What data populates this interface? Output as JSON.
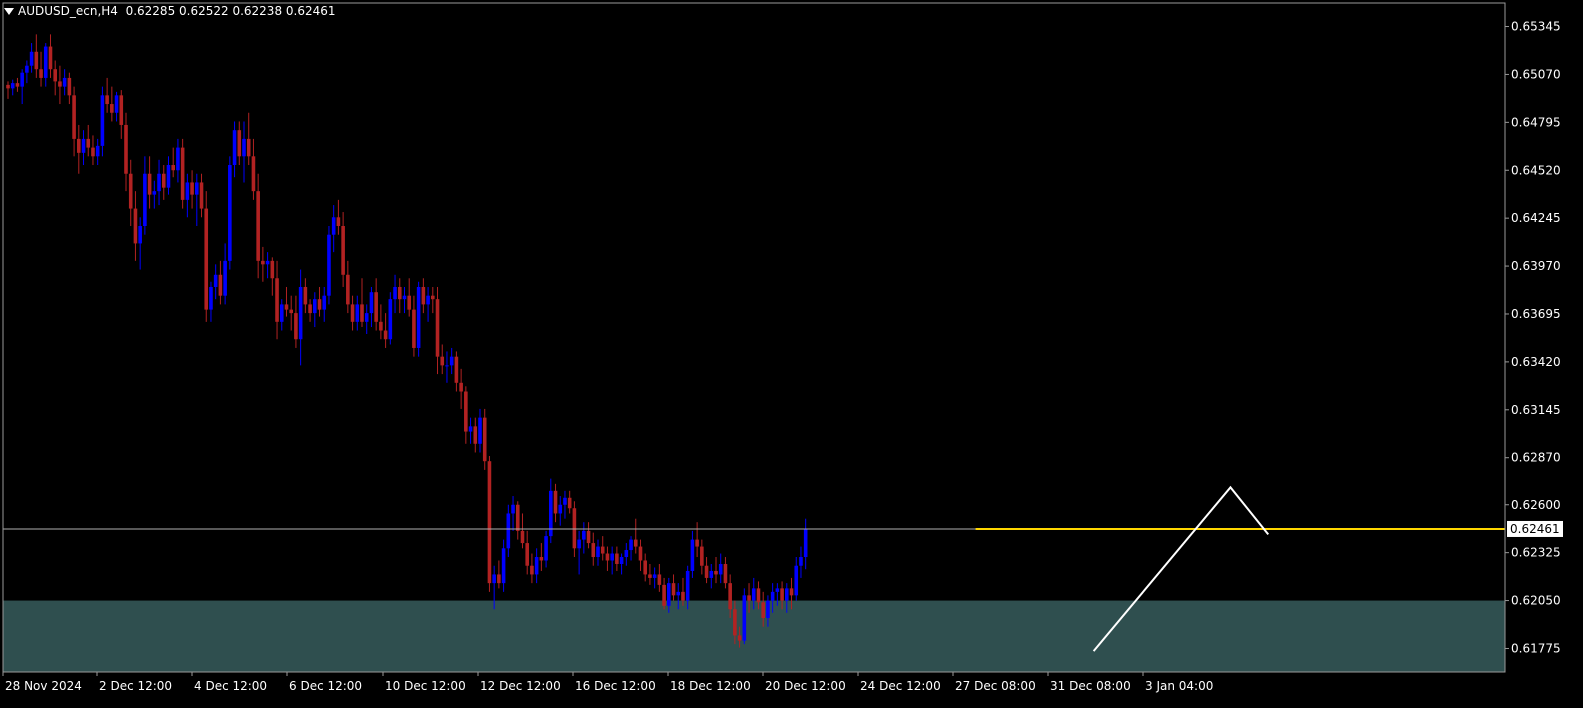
{
  "header": {
    "symbol": "AUDUSD_ecn,H4",
    "ohlc": "0.62285 0.62522 0.62238 0.62461"
  },
  "colors": {
    "background": "#000000",
    "bull": "#0000ff",
    "bear": "#b22222",
    "grid": "#9a9a9a",
    "price_line": "#b0b0b0",
    "level_line": "#ffd700",
    "zone": "#2f4f4f",
    "pattern": "#ffffff",
    "text": "#ffffff"
  },
  "chart_data": {
    "type": "candlestick",
    "symbol": "AUDUSD_ecn",
    "timeframe": "H4",
    "ylim": [
      0.6164,
      0.6548
    ],
    "y_ticks": [
      "0.65345",
      "0.65070",
      "0.64795",
      "0.64520",
      "0.64245",
      "0.63970",
      "0.63695",
      "0.63420",
      "0.63145",
      "0.62870",
      "0.62600",
      "0.62325",
      "0.62050",
      "0.61775"
    ],
    "x_ticks": [
      "28 Nov 2024",
      "2 Dec 12:00",
      "4 Dec 12:00",
      "6 Dec 12:00",
      "10 Dec 12:00",
      "12 Dec 12:00",
      "16 Dec 12:00",
      "18 Dec 12:00",
      "20 Dec 12:00",
      "24 Dec 12:00",
      "27 Dec 08:00",
      "31 Dec 08:00",
      "3 Jan 04:00"
    ],
    "current_price": "0.62461",
    "resistance_level": 0.62461,
    "support_zone": [
      0.6164,
      0.6205
    ],
    "projection_path": [
      {
        "bar": 230,
        "price": 0.6176
      },
      {
        "bar": 259,
        "price": 0.627
      },
      {
        "bar": 267,
        "price": 0.6243
      }
    ],
    "candles": [
      [
        0.6501,
        0.6503,
        0.6493,
        0.6499
      ],
      [
        0.6499,
        0.6504,
        0.6495,
        0.6502
      ],
      [
        0.6502,
        0.6505,
        0.6497,
        0.65
      ],
      [
        0.65,
        0.651,
        0.649,
        0.6508
      ],
      [
        0.6508,
        0.6515,
        0.6502,
        0.6512
      ],
      [
        0.6512,
        0.6525,
        0.6508,
        0.652
      ],
      [
        0.652,
        0.653,
        0.6505,
        0.651
      ],
      [
        0.651,
        0.652,
        0.65,
        0.6505
      ],
      [
        0.6505,
        0.6525,
        0.65,
        0.6523
      ],
      [
        0.6523,
        0.653,
        0.6505,
        0.651
      ],
      [
        0.651,
        0.6515,
        0.6495,
        0.6503
      ],
      [
        0.6503,
        0.6512,
        0.649,
        0.65
      ],
      [
        0.65,
        0.651,
        0.6495,
        0.6505
      ],
      [
        0.6505,
        0.6508,
        0.649,
        0.6495
      ],
      [
        0.6495,
        0.65,
        0.646,
        0.647
      ],
      [
        0.647,
        0.6478,
        0.645,
        0.6462
      ],
      [
        0.6462,
        0.6475,
        0.6455,
        0.647
      ],
      [
        0.647,
        0.6478,
        0.646,
        0.6465
      ],
      [
        0.6465,
        0.6472,
        0.6455,
        0.646
      ],
      [
        0.646,
        0.647,
        0.6455,
        0.6466
      ],
      [
        0.6466,
        0.65,
        0.646,
        0.6495
      ],
      [
        0.6495,
        0.6505,
        0.6485,
        0.649
      ],
      [
        0.649,
        0.65,
        0.648,
        0.6485
      ],
      [
        0.6485,
        0.6497,
        0.648,
        0.6495
      ],
      [
        0.6495,
        0.6498,
        0.647,
        0.6478
      ],
      [
        0.6478,
        0.6485,
        0.644,
        0.645
      ],
      [
        0.645,
        0.6458,
        0.642,
        0.643
      ],
      [
        0.643,
        0.644,
        0.64,
        0.641
      ],
      [
        0.641,
        0.6425,
        0.6395,
        0.642
      ],
      [
        0.642,
        0.646,
        0.6415,
        0.645
      ],
      [
        0.645,
        0.646,
        0.643,
        0.6438
      ],
      [
        0.6438,
        0.6446,
        0.643,
        0.644
      ],
      [
        0.644,
        0.6458,
        0.6432,
        0.645
      ],
      [
        0.645,
        0.6455,
        0.6435,
        0.6442
      ],
      [
        0.6442,
        0.646,
        0.6438,
        0.6455
      ],
      [
        0.6455,
        0.6465,
        0.6448,
        0.6452
      ],
      [
        0.6452,
        0.647,
        0.6445,
        0.6465
      ],
      [
        0.6465,
        0.647,
        0.643,
        0.6435
      ],
      [
        0.6435,
        0.645,
        0.6425,
        0.6445
      ],
      [
        0.6445,
        0.6452,
        0.643,
        0.6438
      ],
      [
        0.6438,
        0.645,
        0.642,
        0.6445
      ],
      [
        0.6445,
        0.645,
        0.6425,
        0.643
      ],
      [
        0.643,
        0.644,
        0.6365,
        0.6372
      ],
      [
        0.6372,
        0.6388,
        0.6365,
        0.6385
      ],
      [
        0.6385,
        0.6398,
        0.6378,
        0.6392
      ],
      [
        0.6392,
        0.64,
        0.6375,
        0.638
      ],
      [
        0.638,
        0.641,
        0.6375,
        0.64
      ],
      [
        0.64,
        0.646,
        0.6395,
        0.6455
      ],
      [
        0.6455,
        0.648,
        0.6448,
        0.6475
      ],
      [
        0.6475,
        0.648,
        0.6455,
        0.646
      ],
      [
        0.646,
        0.648,
        0.6445,
        0.647
      ],
      [
        0.647,
        0.6485,
        0.6455,
        0.646
      ],
      [
        0.646,
        0.647,
        0.6435,
        0.644
      ],
      [
        0.644,
        0.645,
        0.639,
        0.64
      ],
      [
        0.64,
        0.6408,
        0.6388,
        0.6398
      ],
      [
        0.6398,
        0.6405,
        0.639,
        0.64
      ],
      [
        0.64,
        0.6402,
        0.638,
        0.639
      ],
      [
        0.639,
        0.64,
        0.6355,
        0.6365
      ],
      [
        0.6365,
        0.6378,
        0.636,
        0.6375
      ],
      [
        0.6375,
        0.6385,
        0.6368,
        0.6372
      ],
      [
        0.6372,
        0.638,
        0.636,
        0.637
      ],
      [
        0.637,
        0.638,
        0.635,
        0.6355
      ],
      [
        0.6355,
        0.6395,
        0.634,
        0.6385
      ],
      [
        0.6385,
        0.639,
        0.637,
        0.6375
      ],
      [
        0.6375,
        0.6378,
        0.6365,
        0.637
      ],
      [
        0.637,
        0.6382,
        0.6362,
        0.6378
      ],
      [
        0.6378,
        0.6385,
        0.6368,
        0.6372
      ],
      [
        0.6372,
        0.6385,
        0.6365,
        0.638
      ],
      [
        0.638,
        0.642,
        0.6375,
        0.6415
      ],
      [
        0.6415,
        0.6432,
        0.6405,
        0.6425
      ],
      [
        0.6425,
        0.6435,
        0.6415,
        0.642
      ],
      [
        0.642,
        0.6428,
        0.6385,
        0.6392
      ],
      [
        0.6392,
        0.64,
        0.637,
        0.6375
      ],
      [
        0.6375,
        0.638,
        0.636,
        0.6365
      ],
      [
        0.6365,
        0.638,
        0.636,
        0.6375
      ],
      [
        0.6375,
        0.639,
        0.6362,
        0.6365
      ],
      [
        0.6365,
        0.6375,
        0.6358,
        0.637
      ],
      [
        0.637,
        0.6385,
        0.6362,
        0.6382
      ],
      [
        0.6382,
        0.639,
        0.636,
        0.6365
      ],
      [
        0.6365,
        0.6375,
        0.6355,
        0.636
      ],
      [
        0.636,
        0.637,
        0.635,
        0.6355
      ],
      [
        0.6355,
        0.6382,
        0.6352,
        0.6378
      ],
      [
        0.6378,
        0.6392,
        0.637,
        0.6385
      ],
      [
        0.6385,
        0.639,
        0.637,
        0.6378
      ],
      [
        0.6378,
        0.6385,
        0.637,
        0.638
      ],
      [
        0.638,
        0.639,
        0.6368,
        0.6372
      ],
      [
        0.6372,
        0.638,
        0.6345,
        0.635
      ],
      [
        0.635,
        0.6388,
        0.6345,
        0.6385
      ],
      [
        0.6385,
        0.639,
        0.637,
        0.6375
      ],
      [
        0.6375,
        0.6385,
        0.6365,
        0.638
      ],
      [
        0.638,
        0.6385,
        0.637,
        0.6378
      ],
      [
        0.6378,
        0.6385,
        0.6335,
        0.6345
      ],
      [
        0.6345,
        0.6352,
        0.6335,
        0.634
      ],
      [
        0.634,
        0.6348,
        0.633,
        0.634
      ],
      [
        0.634,
        0.635,
        0.6335,
        0.6345
      ],
      [
        0.6345,
        0.6348,
        0.6325,
        0.633
      ],
      [
        0.633,
        0.6338,
        0.6315,
        0.6325
      ],
      [
        0.6325,
        0.6328,
        0.6295,
        0.6302
      ],
      [
        0.6302,
        0.631,
        0.6295,
        0.6305
      ],
      [
        0.6305,
        0.631,
        0.629,
        0.6295
      ],
      [
        0.6295,
        0.6315,
        0.629,
        0.631
      ],
      [
        0.631,
        0.6315,
        0.628,
        0.6285
      ],
      [
        0.6285,
        0.6288,
        0.621,
        0.6215
      ],
      [
        0.6215,
        0.6225,
        0.62,
        0.622
      ],
      [
        0.622,
        0.6228,
        0.6212,
        0.6215
      ],
      [
        0.6215,
        0.624,
        0.621,
        0.6235
      ],
      [
        0.6235,
        0.626,
        0.623,
        0.6255
      ],
      [
        0.6255,
        0.6265,
        0.6245,
        0.626
      ],
      [
        0.626,
        0.6262,
        0.624,
        0.6245
      ],
      [
        0.6245,
        0.6255,
        0.6235,
        0.6238
      ],
      [
        0.6238,
        0.6245,
        0.622,
        0.6225
      ],
      [
        0.6225,
        0.6232,
        0.6215,
        0.622
      ],
      [
        0.622,
        0.6235,
        0.6215,
        0.623
      ],
      [
        0.623,
        0.6238,
        0.6222,
        0.6228
      ],
      [
        0.6228,
        0.6245,
        0.6224,
        0.6242
      ],
      [
        0.6242,
        0.6275,
        0.6238,
        0.6268
      ],
      [
        0.6268,
        0.6272,
        0.625,
        0.6255
      ],
      [
        0.6255,
        0.6265,
        0.6248,
        0.626
      ],
      [
        0.626,
        0.6268,
        0.6252,
        0.6264
      ],
      [
        0.6264,
        0.6268,
        0.6255,
        0.6258
      ],
      [
        0.6258,
        0.6262,
        0.623,
        0.6235
      ],
      [
        0.6235,
        0.6245,
        0.622,
        0.624
      ],
      [
        0.624,
        0.625,
        0.6232,
        0.6245
      ],
      [
        0.6245,
        0.625,
        0.6235,
        0.6238
      ],
      [
        0.6238,
        0.6244,
        0.6225,
        0.623
      ],
      [
        0.623,
        0.624,
        0.6225,
        0.6236
      ],
      [
        0.6236,
        0.6242,
        0.6228,
        0.6232
      ],
      [
        0.6232,
        0.6236,
        0.6222,
        0.6228
      ],
      [
        0.6228,
        0.6236,
        0.622,
        0.6232
      ],
      [
        0.6232,
        0.6236,
        0.6222,
        0.6226
      ],
      [
        0.6226,
        0.6232,
        0.622,
        0.623
      ],
      [
        0.623,
        0.6238,
        0.6225,
        0.6234
      ],
      [
        0.6234,
        0.6242,
        0.6228,
        0.624
      ],
      [
        0.624,
        0.6252,
        0.6232,
        0.6236
      ],
      [
        0.6236,
        0.624,
        0.6222,
        0.6228
      ],
      [
        0.6228,
        0.6232,
        0.6216,
        0.622
      ],
      [
        0.622,
        0.6226,
        0.6214,
        0.6218
      ],
      [
        0.6218,
        0.6224,
        0.6212,
        0.622
      ],
      [
        0.622,
        0.6226,
        0.621,
        0.6214
      ],
      [
        0.6214,
        0.6218,
        0.62,
        0.6202
      ],
      [
        0.6202,
        0.6218,
        0.6198,
        0.6215
      ],
      [
        0.6215,
        0.622,
        0.6205,
        0.6208
      ],
      [
        0.6208,
        0.6215,
        0.62,
        0.621
      ],
      [
        0.621,
        0.6218,
        0.6202,
        0.6205
      ],
      [
        0.6205,
        0.6225,
        0.62,
        0.6222
      ],
      [
        0.6222,
        0.6245,
        0.6218,
        0.624
      ],
      [
        0.624,
        0.625,
        0.623,
        0.6236
      ],
      [
        0.6236,
        0.624,
        0.622,
        0.6225
      ],
      [
        0.6225,
        0.623,
        0.6215,
        0.6218
      ],
      [
        0.6218,
        0.6226,
        0.6212,
        0.6222
      ],
      [
        0.6222,
        0.623,
        0.6215,
        0.622
      ],
      [
        0.622,
        0.6232,
        0.6215,
        0.6226
      ],
      [
        0.6226,
        0.623,
        0.6212,
        0.6215
      ],
      [
        0.6215,
        0.622,
        0.6195,
        0.62
      ],
      [
        0.62,
        0.6205,
        0.618,
        0.6185
      ],
      [
        0.6185,
        0.619,
        0.6178,
        0.6182
      ],
      [
        0.6182,
        0.6212,
        0.618,
        0.6208
      ],
      [
        0.6208,
        0.6215,
        0.6198,
        0.6205
      ],
      [
        0.6205,
        0.6218,
        0.62,
        0.6212
      ],
      [
        0.6212,
        0.6216,
        0.62,
        0.6204
      ],
      [
        0.6204,
        0.621,
        0.619,
        0.6195
      ],
      [
        0.6195,
        0.6208,
        0.619,
        0.6205
      ],
      [
        0.6205,
        0.6215,
        0.6198,
        0.621
      ],
      [
        0.621,
        0.6215,
        0.6202,
        0.6212
      ],
      [
        0.6212,
        0.6216,
        0.62,
        0.6205
      ],
      [
        0.6205,
        0.6215,
        0.6198,
        0.6212
      ],
      [
        0.6212,
        0.6218,
        0.62,
        0.6208
      ],
      [
        0.6208,
        0.623,
        0.6205,
        0.6225
      ],
      [
        0.6225,
        0.6236,
        0.6218,
        0.623
      ],
      [
        0.623,
        0.6252,
        0.6223,
        0.6246
      ]
    ]
  }
}
